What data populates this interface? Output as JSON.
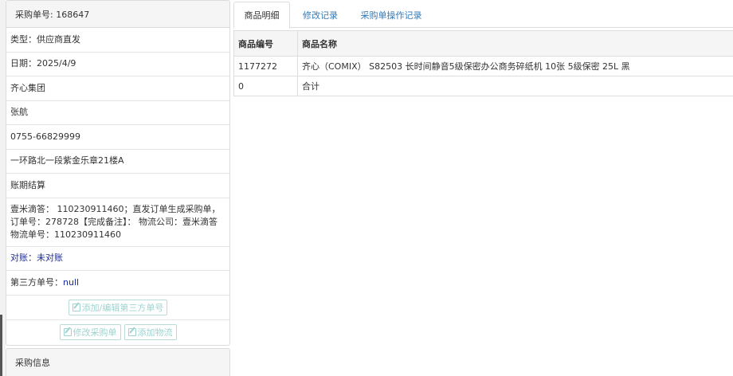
{
  "order": {
    "header": "采购单号: 168647",
    "type": "类型：供应商直发",
    "date": "日期：2025/4/9",
    "company": "齐心集团",
    "contact": "张航",
    "phone": "0755-66829999",
    "address": "一环路北一段紫金乐章21楼A",
    "settlement": "账期结算",
    "remark": "壹米滴答： 110230911460；直发订单生成采购单，订单号：278728【完成备注】： 物流公司：壹米滴答 物流单号：110230911460",
    "reconcile_label": "对账：",
    "reconcile_value": "未对账",
    "third_party_label": "第三方单号：",
    "third_party_value": "null",
    "btn_third_party": "添加/编辑第三方单号",
    "btn_edit_order": "修改采购单",
    "btn_add_logistics": "添加物流"
  },
  "purchase_info": {
    "title": "采购信息"
  },
  "tabs": [
    {
      "label": "商品明细",
      "active": true
    },
    {
      "label": "修改记录",
      "active": false
    },
    {
      "label": "采购单操作记录",
      "active": false
    }
  ],
  "table": {
    "columns": [
      "商品编号",
      "商品名称"
    ],
    "rows": [
      [
        "1177272",
        "齐心（COMIX） S82503 长时间静音5级保密办公商务碎纸机 10张 5级保密 25L 黑"
      ],
      [
        "0",
        "合计"
      ]
    ]
  },
  "colors": {
    "tab_link": "#337ab7",
    "status_text": "#1a2a9a",
    "disabled_button": "#9fd3cf"
  }
}
